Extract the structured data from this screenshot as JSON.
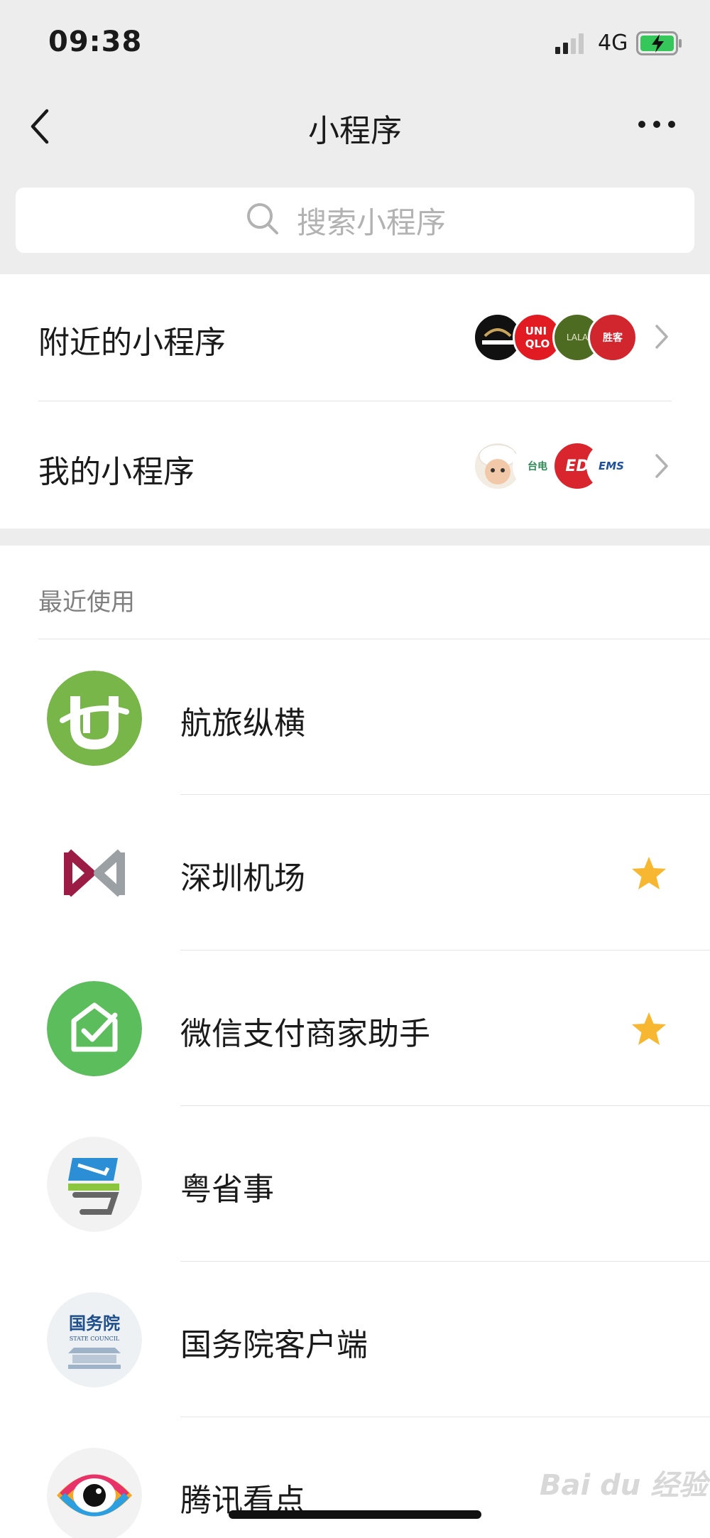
{
  "status": {
    "time": "09:38",
    "network": "4G"
  },
  "nav": {
    "title": "小程序",
    "back_icon": "chevron-left-icon",
    "more_icon": "more-dots-icon"
  },
  "search": {
    "placeholder": "搜索小程序"
  },
  "entries": [
    {
      "label": "附近的小程序",
      "thumbs": [
        "pool.ico",
        "UNIQLO",
        "LALA",
        "胜客"
      ]
    },
    {
      "label": "我的小程序",
      "thumbs": [
        "baby-photo",
        "台电",
        "ED",
        "EMS"
      ]
    }
  ],
  "recent": {
    "title": "最近使用",
    "items": [
      {
        "label": "航旅纵横",
        "starred": false
      },
      {
        "label": "深圳机场",
        "starred": true
      },
      {
        "label": "微信支付商家助手",
        "starred": true
      },
      {
        "label": "粤省事",
        "starred": false
      },
      {
        "label": "国务院客户端",
        "starred": false
      },
      {
        "label": "腾讯看点",
        "starred": false
      }
    ]
  },
  "watermark": "Bai du 经验",
  "colors": {
    "accent_green": "#5cbd5c",
    "star": "#f7b731",
    "background": "#ededed"
  }
}
